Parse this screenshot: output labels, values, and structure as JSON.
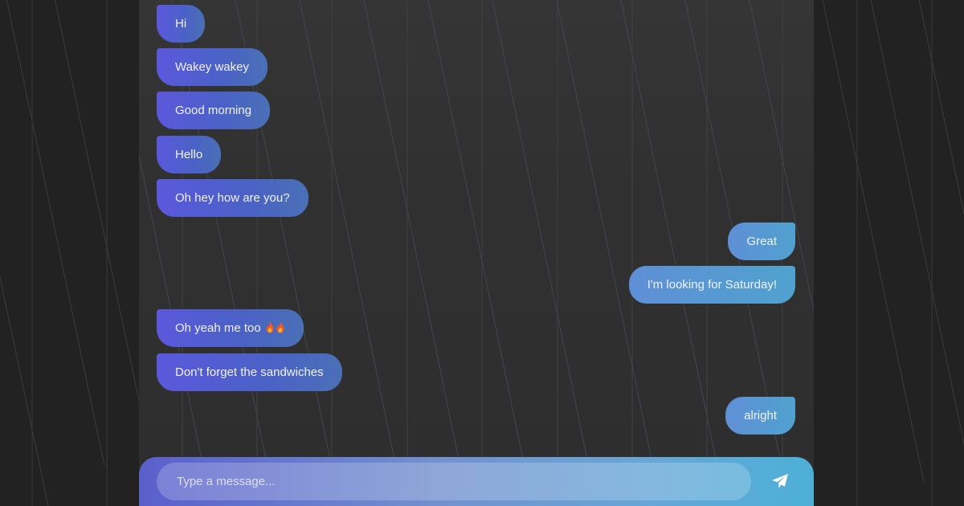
{
  "colors": {
    "page_background": "#222222",
    "panel_background": "#323232",
    "incoming_bubble": "#5558d8",
    "outgoing_bubble": "#56a0d2",
    "composer_gradient_start": "#5a5fcb",
    "composer_gradient_end": "#4db0d7"
  },
  "messages": [
    {
      "side": "left",
      "text": "Hi"
    },
    {
      "side": "left",
      "text": "Wakey wakey"
    },
    {
      "side": "left",
      "text": "Good morning"
    },
    {
      "side": "left",
      "text": "Hello"
    },
    {
      "side": "left",
      "text": "Oh hey how are you?"
    },
    {
      "side": "right",
      "text": "Great"
    },
    {
      "side": "right",
      "text": "I'm looking for Saturday!"
    },
    {
      "side": "left",
      "text": "Oh yeah me too",
      "emoji": "fire-icon fire-icon"
    },
    {
      "side": "left",
      "text": "Don't forget the sandwiches"
    },
    {
      "side": "right",
      "text": "alright"
    }
  ],
  "composer": {
    "placeholder": "Type a message...",
    "value": "",
    "send_icon": "paper-plane-icon"
  }
}
